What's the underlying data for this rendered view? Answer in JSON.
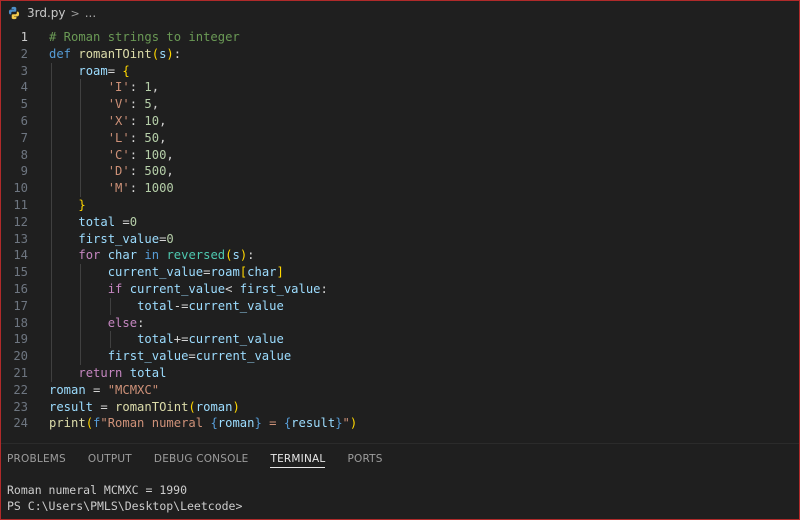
{
  "breadcrumb": {
    "file": "3rd.py",
    "separator": ">",
    "more": "..."
  },
  "editor": {
    "active_line": 1,
    "lines": [
      {
        "n": "1",
        "tokens": [
          {
            "c": "cm",
            "t": "# Roman strings to integer"
          }
        ]
      },
      {
        "n": "2",
        "tokens": [
          {
            "c": "kw",
            "t": "def "
          },
          {
            "c": "fn",
            "t": "romanTOint"
          },
          {
            "c": "b1",
            "t": "("
          },
          {
            "c": "var",
            "t": "s"
          },
          {
            "c": "b1",
            "t": ")"
          },
          {
            "c": "op",
            "t": ":"
          }
        ]
      },
      {
        "n": "3",
        "tokens": [
          {
            "c": "op",
            "t": "    "
          },
          {
            "c": "var",
            "t": "roam"
          },
          {
            "c": "op",
            "t": "= "
          },
          {
            "c": "b1",
            "t": "{"
          }
        ]
      },
      {
        "n": "4",
        "tokens": [
          {
            "c": "op",
            "t": "        "
          },
          {
            "c": "str",
            "t": "'I'"
          },
          {
            "c": "op",
            "t": ": "
          },
          {
            "c": "num",
            "t": "1"
          },
          {
            "c": "op",
            "t": ","
          }
        ]
      },
      {
        "n": "5",
        "tokens": [
          {
            "c": "op",
            "t": "        "
          },
          {
            "c": "str",
            "t": "'V'"
          },
          {
            "c": "op",
            "t": ": "
          },
          {
            "c": "num",
            "t": "5"
          },
          {
            "c": "op",
            "t": ","
          }
        ]
      },
      {
        "n": "6",
        "tokens": [
          {
            "c": "op",
            "t": "        "
          },
          {
            "c": "str",
            "t": "'X'"
          },
          {
            "c": "op",
            "t": ": "
          },
          {
            "c": "num",
            "t": "10"
          },
          {
            "c": "op",
            "t": ","
          }
        ]
      },
      {
        "n": "7",
        "tokens": [
          {
            "c": "op",
            "t": "        "
          },
          {
            "c": "str",
            "t": "'L'"
          },
          {
            "c": "op",
            "t": ": "
          },
          {
            "c": "num",
            "t": "50"
          },
          {
            "c": "op",
            "t": ","
          }
        ]
      },
      {
        "n": "8",
        "tokens": [
          {
            "c": "op",
            "t": "        "
          },
          {
            "c": "str",
            "t": "'C'"
          },
          {
            "c": "op",
            "t": ": "
          },
          {
            "c": "num",
            "t": "100"
          },
          {
            "c": "op",
            "t": ","
          }
        ]
      },
      {
        "n": "9",
        "tokens": [
          {
            "c": "op",
            "t": "        "
          },
          {
            "c": "str",
            "t": "'D'"
          },
          {
            "c": "op",
            "t": ": "
          },
          {
            "c": "num",
            "t": "500"
          },
          {
            "c": "op",
            "t": ","
          }
        ]
      },
      {
        "n": "10",
        "tokens": [
          {
            "c": "op",
            "t": "        "
          },
          {
            "c": "str",
            "t": "'M'"
          },
          {
            "c": "op",
            "t": ": "
          },
          {
            "c": "num",
            "t": "1000"
          }
        ]
      },
      {
        "n": "11",
        "tokens": [
          {
            "c": "op",
            "t": "    "
          },
          {
            "c": "b1",
            "t": "}"
          }
        ]
      },
      {
        "n": "12",
        "tokens": [
          {
            "c": "op",
            "t": "    "
          },
          {
            "c": "var",
            "t": "total"
          },
          {
            "c": "op",
            "t": " ="
          },
          {
            "c": "num",
            "t": "0"
          }
        ]
      },
      {
        "n": "13",
        "tokens": [
          {
            "c": "op",
            "t": "    "
          },
          {
            "c": "var",
            "t": "first_value"
          },
          {
            "c": "op",
            "t": "="
          },
          {
            "c": "num",
            "t": "0"
          }
        ]
      },
      {
        "n": "14",
        "tokens": [
          {
            "c": "op",
            "t": "    "
          },
          {
            "c": "ctl",
            "t": "for "
          },
          {
            "c": "var",
            "t": "char"
          },
          {
            "c": "kw",
            "t": " in "
          },
          {
            "c": "bi",
            "t": "reversed"
          },
          {
            "c": "b1",
            "t": "("
          },
          {
            "c": "var",
            "t": "s"
          },
          {
            "c": "b1",
            "t": ")"
          },
          {
            "c": "op",
            "t": ":"
          }
        ]
      },
      {
        "n": "15",
        "tokens": [
          {
            "c": "op",
            "t": "        "
          },
          {
            "c": "var",
            "t": "current_value"
          },
          {
            "c": "op",
            "t": "="
          },
          {
            "c": "var",
            "t": "roam"
          },
          {
            "c": "b1",
            "t": "["
          },
          {
            "c": "var",
            "t": "char"
          },
          {
            "c": "b1",
            "t": "]"
          }
        ]
      },
      {
        "n": "16",
        "tokens": [
          {
            "c": "op",
            "t": "        "
          },
          {
            "c": "ctl",
            "t": "if "
          },
          {
            "c": "var",
            "t": "current_value"
          },
          {
            "c": "op",
            "t": "< "
          },
          {
            "c": "var",
            "t": "first_value"
          },
          {
            "c": "op",
            "t": ":"
          }
        ]
      },
      {
        "n": "17",
        "tokens": [
          {
            "c": "op",
            "t": "            "
          },
          {
            "c": "var",
            "t": "total"
          },
          {
            "c": "op",
            "t": "-="
          },
          {
            "c": "var",
            "t": "current_value"
          }
        ]
      },
      {
        "n": "18",
        "tokens": [
          {
            "c": "op",
            "t": "        "
          },
          {
            "c": "ctl",
            "t": "else"
          },
          {
            "c": "op",
            "t": ":"
          }
        ]
      },
      {
        "n": "19",
        "tokens": [
          {
            "c": "op",
            "t": "            "
          },
          {
            "c": "var",
            "t": "total"
          },
          {
            "c": "op",
            "t": "+="
          },
          {
            "c": "var",
            "t": "current_value"
          }
        ]
      },
      {
        "n": "20",
        "tokens": [
          {
            "c": "op",
            "t": "        "
          },
          {
            "c": "var",
            "t": "first_value"
          },
          {
            "c": "op",
            "t": "="
          },
          {
            "c": "var",
            "t": "current_value"
          }
        ]
      },
      {
        "n": "21",
        "tokens": [
          {
            "c": "op",
            "t": "    "
          },
          {
            "c": "ctl",
            "t": "return "
          },
          {
            "c": "var",
            "t": "total"
          }
        ]
      },
      {
        "n": "22",
        "tokens": [
          {
            "c": "var",
            "t": "roman"
          },
          {
            "c": "op",
            "t": " = "
          },
          {
            "c": "str",
            "t": "\"MCMXC\""
          }
        ]
      },
      {
        "n": "23",
        "tokens": [
          {
            "c": "var",
            "t": "result"
          },
          {
            "c": "op",
            "t": " = "
          },
          {
            "c": "fn",
            "t": "romanTOint"
          },
          {
            "c": "b1",
            "t": "("
          },
          {
            "c": "var",
            "t": "roman"
          },
          {
            "c": "b1",
            "t": ")"
          }
        ]
      },
      {
        "n": "24",
        "tokens": [
          {
            "c": "fn",
            "t": "print"
          },
          {
            "c": "b1",
            "t": "("
          },
          {
            "c": "kw",
            "t": "f"
          },
          {
            "c": "str",
            "t": "\"Roman numeral "
          },
          {
            "c": "kw",
            "t": "{"
          },
          {
            "c": "var",
            "t": "roman"
          },
          {
            "c": "kw",
            "t": "}"
          },
          {
            "c": "str",
            "t": " = "
          },
          {
            "c": "kw",
            "t": "{"
          },
          {
            "c": "var",
            "t": "result"
          },
          {
            "c": "kw",
            "t": "}"
          },
          {
            "c": "str",
            "t": "\""
          },
          {
            "c": "b1",
            "t": ")"
          }
        ]
      }
    ]
  },
  "panel": {
    "tabs": [
      {
        "label": "PROBLEMS",
        "active": false
      },
      {
        "label": "OUTPUT",
        "active": false
      },
      {
        "label": "DEBUG CONSOLE",
        "active": false
      },
      {
        "label": "TERMINAL",
        "active": true
      },
      {
        "label": "PORTS",
        "active": false
      }
    ],
    "terminal_lines": [
      "Roman numeral MCMXC = 1990",
      "PS C:\\Users\\PMLS\\Desktop\\Leetcode>"
    ]
  }
}
